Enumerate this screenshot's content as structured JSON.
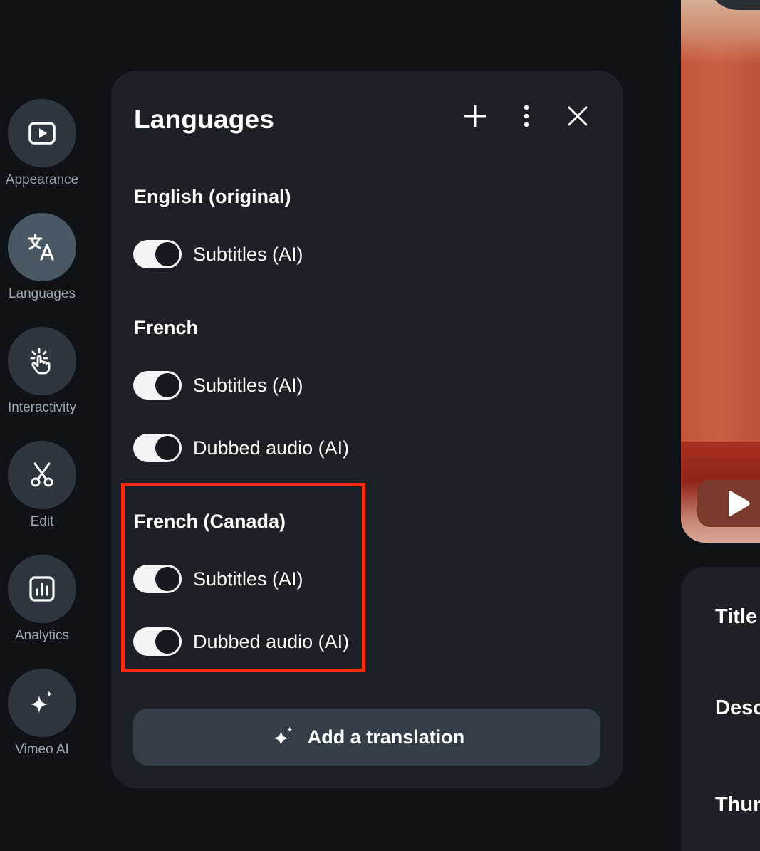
{
  "rail": {
    "items": [
      {
        "label": "Appearance",
        "icon": "play-box-icon",
        "active": false
      },
      {
        "label": "Languages",
        "icon": "translate-icon",
        "active": true
      },
      {
        "label": "Interactivity",
        "icon": "tap-hand-icon",
        "active": false
      },
      {
        "label": "Edit",
        "icon": "scissors-icon",
        "active": false
      },
      {
        "label": "Analytics",
        "icon": "bar-chart-icon",
        "active": false
      },
      {
        "label": "Vimeo AI",
        "icon": "sparkle-icon",
        "active": false
      }
    ]
  },
  "panel": {
    "title": "Languages",
    "actions": {
      "add": "plus-icon",
      "more": "more-vertical-icon",
      "close": "close-icon"
    },
    "sections": [
      {
        "name": "English (original)",
        "toggles": [
          {
            "label": "Subtitles (AI)",
            "on": true
          }
        ]
      },
      {
        "name": "French",
        "toggles": [
          {
            "label": "Subtitles (AI)",
            "on": true
          },
          {
            "label": "Dubbed audio (AI)",
            "on": true
          }
        ]
      },
      {
        "name": "French (Canada)",
        "toggles": [
          {
            "label": "Subtitles (AI)",
            "on": true
          },
          {
            "label": "Dubbed audio (AI)",
            "on": true
          }
        ]
      }
    ],
    "add_translation_label": "Add a translation"
  },
  "details": {
    "fields": [
      "Title",
      "Description",
      "Thumbnail"
    ]
  },
  "colors": {
    "background": "#0f1318",
    "panel": "#1c2127",
    "highlight": "#ff2a10",
    "toggle_on": "#f3f4f6"
  }
}
